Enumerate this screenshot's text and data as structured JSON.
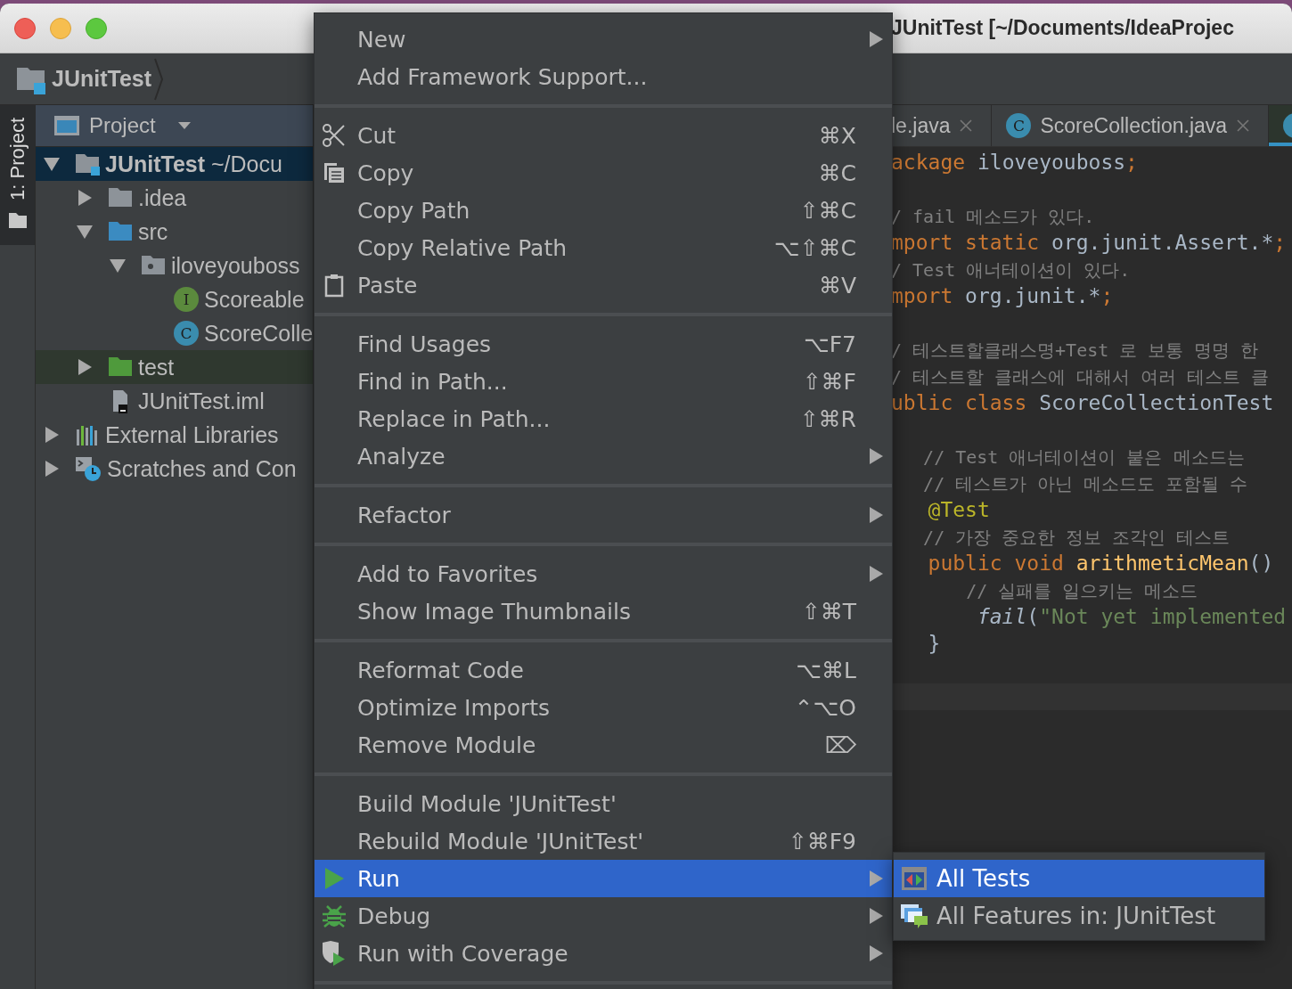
{
  "window": {
    "title": "JUnitTest [~/Documents/IdeaProjec"
  },
  "breadcrumb": {
    "label": "JUnitTest"
  },
  "tool_strip": {
    "tabs": [
      {
        "label": "1: Project",
        "selected": true
      }
    ]
  },
  "project": {
    "title": "Project",
    "tree": [
      {
        "label": "**JUnitTest** ~/Docu",
        "kind": "module",
        "selected": true,
        "expanded": true,
        "children": [
          {
            "label": ".idea",
            "kind": "folder",
            "selected": false,
            "expanded": false
          },
          {
            "label": "src",
            "kind": "source-folder",
            "selected": false,
            "expanded": true,
            "children": [
              {
                "label": "iloveyouboss",
                "kind": "package",
                "selected": false,
                "expanded": true,
                "children": [
                  {
                    "label": "Scoreable",
                    "kind": "interface",
                    "icon_letter": "I",
                    "selected": false
                  },
                  {
                    "label": "ScoreColle",
                    "kind": "class",
                    "icon_letter": "C",
                    "selected": false
                  }
                ]
              }
            ]
          },
          {
            "label": "test",
            "kind": "test-folder",
            "selected": false,
            "expanded": false
          },
          {
            "label": "JUnitTest.iml",
            "kind": "module-file",
            "selected": false
          }
        ]
      },
      {
        "label": "External Libraries",
        "kind": "libraries",
        "selected": false,
        "expanded": false
      },
      {
        "label": "Scratches and Con",
        "kind": "scratches",
        "selected": false,
        "expanded": false
      }
    ]
  },
  "editor": {
    "tabs": [
      {
        "label": "le.java",
        "selected": false
      },
      {
        "label": "ScoreCollection.java",
        "icon_letter": "C",
        "selected": false
      },
      {
        "selected": true
      }
    ],
    "lines": [
      {
        "kind": "code",
        "current": false,
        "tokens": [
          {
            "text": "ackage",
            "kind": "keyword"
          },
          {
            "text": " iloveyouboss",
            "kind": "plain"
          },
          {
            "text": ";",
            "kind": "keyword"
          }
        ]
      },
      {
        "kind": "blank",
        "current": false
      },
      {
        "kind": "code",
        "current": false,
        "tokens": [
          {
            "text": "/ fail 메소드가 있다.",
            "kind": "comment"
          }
        ]
      },
      {
        "kind": "code",
        "current": false,
        "tokens": [
          {
            "text": "mport static",
            "kind": "keyword"
          },
          {
            "text": " org.junit.Assert.*",
            "kind": "plain"
          },
          {
            "text": ";",
            "kind": "keyword"
          }
        ]
      },
      {
        "kind": "code",
        "current": false,
        "tokens": [
          {
            "text": "/ Test 애너테이션이 있다.",
            "kind": "comment"
          }
        ]
      },
      {
        "kind": "code",
        "current": false,
        "tokens": [
          {
            "text": "mport",
            "kind": "keyword"
          },
          {
            "text": " org.junit.*",
            "kind": "plain"
          },
          {
            "text": ";",
            "kind": "keyword"
          }
        ]
      },
      {
        "kind": "blank",
        "current": false
      },
      {
        "kind": "code",
        "current": false,
        "tokens": [
          {
            "text": "/ 테스트할클래스명+Test 로 보통 명명 한",
            "kind": "comment"
          }
        ]
      },
      {
        "kind": "code",
        "current": false,
        "tokens": [
          {
            "text": "/ 테스트할 클래스에 대해서 여러 테스트 클",
            "kind": "comment"
          }
        ]
      },
      {
        "kind": "code",
        "current": false,
        "tokens": [
          {
            "text": "ublic class",
            "kind": "keyword"
          },
          {
            "text": " ScoreCollectionTest",
            "kind": "plain"
          }
        ]
      },
      {
        "kind": "blank",
        "current": false
      },
      {
        "kind": "code",
        "current": false,
        "tokens": [
          {
            "text": "   // Test 애너테이션이 붙은 메소드는",
            "kind": "comment"
          }
        ]
      },
      {
        "kind": "code",
        "current": false,
        "tokens": [
          {
            "text": "   // 테스트가 아닌 메소드도 포함될 수",
            "kind": "comment"
          }
        ]
      },
      {
        "kind": "code",
        "current": false,
        "tokens": [
          {
            "text": "   @Test",
            "kind": "annotation"
          }
        ]
      },
      {
        "kind": "code",
        "current": false,
        "tokens": [
          {
            "text": "   // 가장 중요한 정보 조각인 테스트",
            "kind": "comment"
          }
        ]
      },
      {
        "kind": "code",
        "current": false,
        "tokens": [
          {
            "text": "   public void",
            "kind": "keyword"
          },
          {
            "text": " arithmeticMean",
            "kind": "method"
          },
          {
            "text": "()",
            "kind": "plain"
          }
        ]
      },
      {
        "kind": "code",
        "current": false,
        "tokens": [
          {
            "text": "       // 실패를 일으키는 메소드",
            "kind": "comment"
          }
        ]
      },
      {
        "kind": "code",
        "current": false,
        "tokens": [
          {
            "text": "       fail",
            "kind": "call"
          },
          {
            "text": "(",
            "kind": "plain"
          },
          {
            "text": "\"Not yet implemented",
            "kind": "string"
          }
        ]
      },
      {
        "kind": "code",
        "current": false,
        "tokens": [
          {
            "text": "   }",
            "kind": "plain"
          }
        ]
      },
      {
        "kind": "blank",
        "current": false
      },
      {
        "kind": "blank",
        "current": true
      }
    ]
  },
  "context_menu": {
    "sections": [
      {
        "items": [
          {
            "label": "New",
            "kind": "plain",
            "submenu": true,
            "selected": false
          },
          {
            "label": "Add Framework Support...",
            "kind": "plain",
            "submenu": false,
            "selected": false
          }
        ]
      },
      {
        "items": [
          {
            "label": "Cut",
            "shortcut": "⌘X",
            "kind": "cut",
            "submenu": false,
            "selected": false
          },
          {
            "label": "Copy",
            "shortcut": "⌘C",
            "kind": "copy",
            "submenu": false,
            "selected": false
          },
          {
            "label": "Copy Path",
            "shortcut": "⇧⌘C",
            "kind": "plain",
            "submenu": false,
            "selected": false
          },
          {
            "label": "Copy Relative Path",
            "shortcut": "⌥⇧⌘C",
            "kind": "plain",
            "submenu": false,
            "selected": false
          },
          {
            "label": "Paste",
            "shortcut": "⌘V",
            "kind": "paste",
            "submenu": false,
            "selected": false
          }
        ]
      },
      {
        "items": [
          {
            "label": "Find Usages",
            "shortcut": "⌥F7",
            "kind": "plain",
            "submenu": false,
            "selected": false
          },
          {
            "label": "Find in Path...",
            "shortcut": "⇧⌘F",
            "kind": "plain",
            "submenu": false,
            "selected": false
          },
          {
            "label": "Replace in Path...",
            "shortcut": "⇧⌘R",
            "kind": "plain",
            "submenu": false,
            "selected": false
          },
          {
            "label": "Analyze",
            "kind": "plain",
            "submenu": true,
            "selected": false
          }
        ]
      },
      {
        "items": [
          {
            "label": "Refactor",
            "kind": "plain",
            "submenu": true,
            "selected": false
          }
        ]
      },
      {
        "items": [
          {
            "label": "Add to Favorites",
            "kind": "plain",
            "submenu": true,
            "selected": false
          },
          {
            "label": "Show Image Thumbnails",
            "shortcut": "⇧⌘T",
            "kind": "plain",
            "submenu": false,
            "selected": false
          }
        ]
      },
      {
        "items": [
          {
            "label": "Reformat Code",
            "shortcut": "⌥⌘L",
            "kind": "plain",
            "submenu": false,
            "selected": false
          },
          {
            "label": "Optimize Imports",
            "shortcut": "⌃⌥O",
            "kind": "plain",
            "submenu": false,
            "selected": false
          },
          {
            "label": "Remove Module",
            "shortcut": "⌦",
            "kind": "plain",
            "submenu": false,
            "selected": false
          }
        ]
      },
      {
        "items": [
          {
            "label": "Build Module 'JUnitTest'",
            "kind": "plain",
            "submenu": false,
            "selected": false
          },
          {
            "label": "Rebuild Module 'JUnitTest'",
            "shortcut": "⇧⌘F9",
            "kind": "plain",
            "submenu": false,
            "selected": false
          },
          {
            "label": "Run",
            "kind": "run",
            "submenu": true,
            "selected": true
          },
          {
            "label": "Debug",
            "kind": "debug",
            "submenu": true,
            "selected": false
          },
          {
            "label": "Run with Coverage",
            "kind": "coverage",
            "submenu": true,
            "selected": false
          }
        ]
      }
    ]
  },
  "submenu": {
    "items": [
      {
        "label": "All Tests",
        "kind": "tests",
        "selected": true
      },
      {
        "label": "All Features in: JUnitTest",
        "kind": "features",
        "selected": false
      }
    ]
  }
}
